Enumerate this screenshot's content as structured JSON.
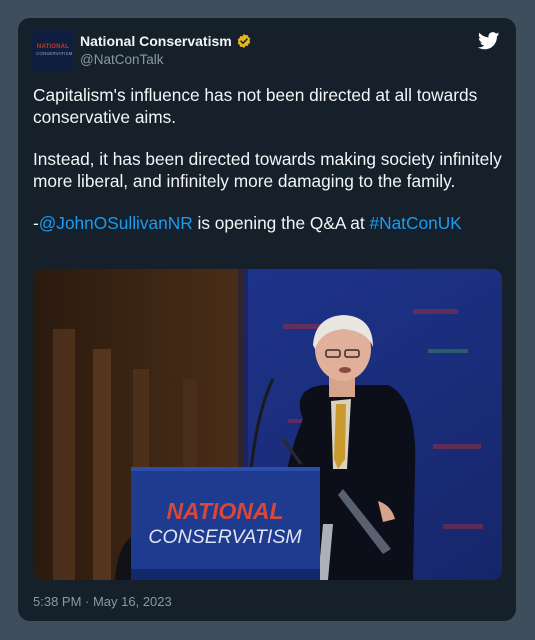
{
  "tweet": {
    "author_name": "National Conservatism",
    "author_handle": "@NatConTalk",
    "avatar_logo_text": "NATIONAL",
    "avatar_logo_subtext": "CONSERVATISM",
    "paragraph_1": "Capitalism's influence has not been directed at all towards conservative aims.",
    "paragraph_2": "Instead, it has been directed towards making society infinitely more liberal, and infinitely more damaging to the family.",
    "paragraph_3_prefix": "-",
    "mention": "@JohnOSullivanNR",
    "paragraph_3_middle": " is opening the Q&A at ",
    "hashtag": "#NatConUK",
    "timestamp": "5:38 PM · May 16, 2023"
  },
  "media": {
    "podium_line_1": "NATIONAL",
    "podium_line_2": "CONSERVATISM"
  },
  "icons": {
    "verified": "verified-badge-icon",
    "platform": "twitter-bird-icon"
  },
  "colors": {
    "card_background": "#15202b",
    "page_background": "#3f4e5c",
    "link": "#1d9bf0",
    "secondary_text": "#8b98a5",
    "verified_badge": "#e2b719"
  }
}
